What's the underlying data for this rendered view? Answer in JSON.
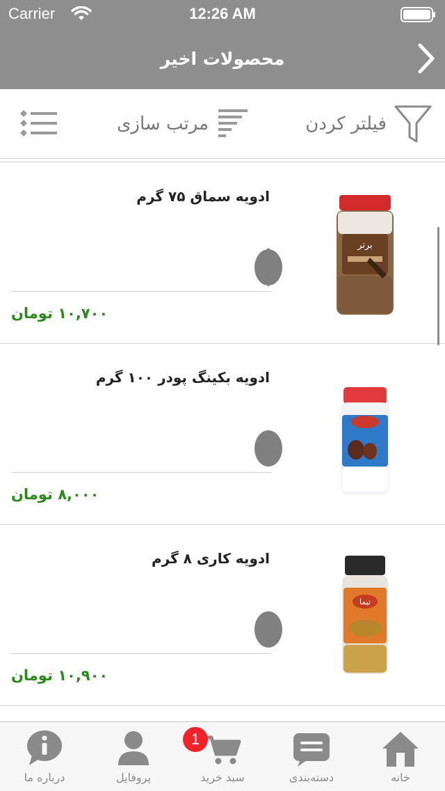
{
  "status_bar": {
    "carrier": "Carrier",
    "time": "12:26 AM"
  },
  "nav": {
    "title": "محصولات اخیر"
  },
  "toolbar": {
    "filter_label": "فیلتر کردن",
    "sort_label": "مرتب سازی"
  },
  "products": [
    {
      "name": "ادویه سماق ۷۵ گرم",
      "price": "۱۰,۷۰۰  تومان",
      "image": "sumac-jar"
    },
    {
      "name": "ادویه بکینگ پودر ۱۰۰ گرم",
      "price": "۸,۰۰۰  تومان",
      "image": "baking-powder-jar"
    },
    {
      "name": "ادویه کاری ۸ گرم",
      "price": "۱۰,۹۰۰  تومان",
      "image": "curry-jar"
    }
  ],
  "tabs": [
    {
      "label": "خانه",
      "icon": "home-icon"
    },
    {
      "label": "دسته‌بندی",
      "icon": "category-icon"
    },
    {
      "label": "سبد خرید",
      "icon": "cart-icon"
    },
    {
      "label": "پروفایل",
      "icon": "profile-icon"
    },
    {
      "label": "درباره ما",
      "icon": "info-icon"
    }
  ],
  "cart_badge": "1",
  "colors": {
    "header": "#8e8e8e",
    "price": "#2c8a1c",
    "badge": "#f0222a",
    "icon_gray": "#8a8a8a"
  }
}
